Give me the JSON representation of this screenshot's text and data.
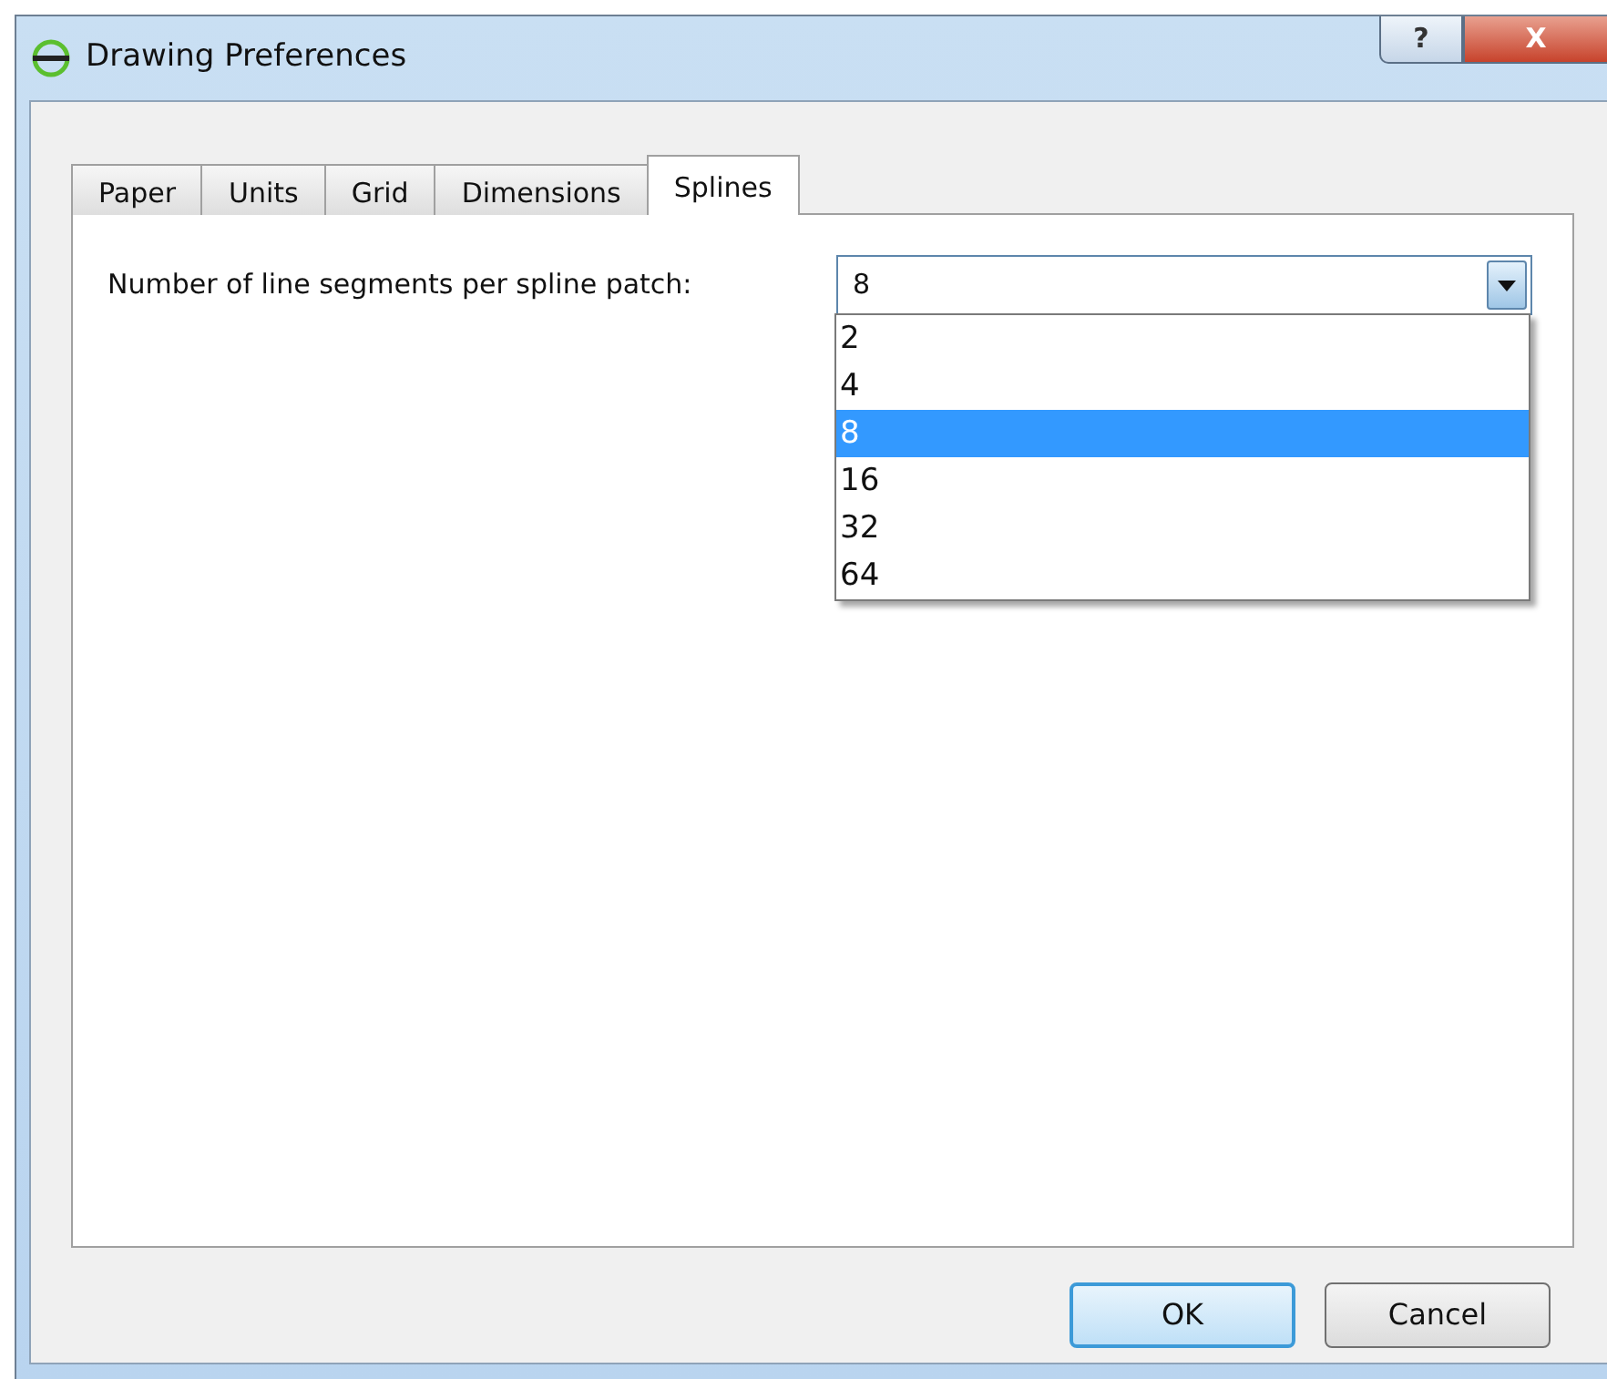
{
  "window": {
    "title": "Drawing Preferences",
    "help_button": "?",
    "close_button": "X"
  },
  "tabs": [
    {
      "label": "Paper",
      "selected": false
    },
    {
      "label": "Units",
      "selected": false
    },
    {
      "label": "Grid",
      "selected": false
    },
    {
      "label": "Dimensions",
      "selected": false
    },
    {
      "label": "Splines",
      "selected": true
    }
  ],
  "field": {
    "label": "Number of line segments per spline patch:",
    "value": "8",
    "expanded": true
  },
  "options": [
    {
      "label": "2",
      "selected": false
    },
    {
      "label": "4",
      "selected": false
    },
    {
      "label": "8",
      "selected": true
    },
    {
      "label": "16",
      "selected": false
    },
    {
      "label": "32",
      "selected": false
    },
    {
      "label": "64",
      "selected": false
    }
  ],
  "buttons": [
    {
      "label": "OK",
      "default": true
    },
    {
      "label": "Cancel",
      "default": false
    }
  ]
}
